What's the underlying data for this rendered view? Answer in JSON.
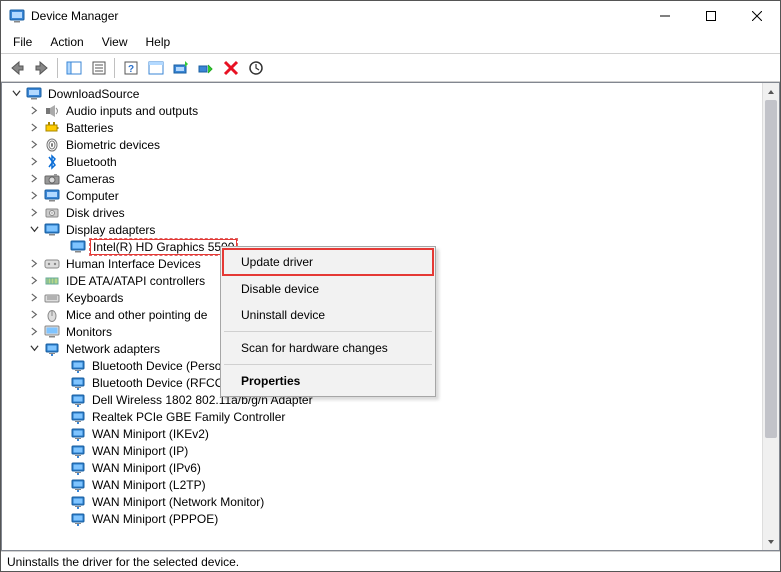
{
  "window": {
    "title": "Device Manager"
  },
  "menus": {
    "file": "File",
    "action": "Action",
    "view": "View",
    "help": "Help"
  },
  "status": "Uninstalls the driver for the selected device.",
  "root": "DownloadSource",
  "categories": [
    {
      "label": "Audio inputs and outputs",
      "icon": "audio",
      "collapsed": true
    },
    {
      "label": "Batteries",
      "icon": "battery",
      "collapsed": true
    },
    {
      "label": "Biometric devices",
      "icon": "biometric",
      "collapsed": true
    },
    {
      "label": "Bluetooth",
      "icon": "bluetooth",
      "collapsed": true
    },
    {
      "label": "Cameras",
      "icon": "camera",
      "collapsed": true
    },
    {
      "label": "Computer",
      "icon": "computer",
      "collapsed": true
    },
    {
      "label": "Disk drives",
      "icon": "disk",
      "collapsed": true
    },
    {
      "label": "Display adapters",
      "icon": "display",
      "collapsed": false,
      "children": [
        {
          "label": "Intel(R) HD Graphics 5500",
          "icon": "display",
          "selected": true
        }
      ]
    },
    {
      "label": "Human Interface Devices",
      "icon": "hid",
      "collapsed": true
    },
    {
      "label": "IDE ATA/ATAPI controllers",
      "icon": "ide",
      "collapsed": true
    },
    {
      "label": "Keyboards",
      "icon": "keyboard",
      "collapsed": true
    },
    {
      "label": "Mice and other pointing de",
      "icon": "mouse",
      "collapsed": true,
      "truncated": true
    },
    {
      "label": "Monitors",
      "icon": "monitor",
      "collapsed": true
    },
    {
      "label": "Network adapters",
      "icon": "network",
      "collapsed": false,
      "children": [
        {
          "label": "Bluetooth Device (Perso",
          "icon": "network",
          "truncated": true
        },
        {
          "label": "Bluetooth Device (RFCOMM Protocol TDI)",
          "icon": "network"
        },
        {
          "label": "Dell Wireless 1802 802.11a/b/g/n Adapter",
          "icon": "network"
        },
        {
          "label": "Realtek PCIe GBE Family Controller",
          "icon": "network"
        },
        {
          "label": "WAN Miniport (IKEv2)",
          "icon": "network"
        },
        {
          "label": "WAN Miniport (IP)",
          "icon": "network"
        },
        {
          "label": "WAN Miniport (IPv6)",
          "icon": "network"
        },
        {
          "label": "WAN Miniport (L2TP)",
          "icon": "network"
        },
        {
          "label": "WAN Miniport (Network Monitor)",
          "icon": "network"
        },
        {
          "label": "WAN Miniport (PPPOE)",
          "icon": "network",
          "cutoff": true
        }
      ]
    }
  ],
  "context_menu": {
    "items": [
      {
        "label": "Update driver",
        "highlighted": true
      },
      {
        "label": "Disable device"
      },
      {
        "label": "Uninstall device"
      },
      {
        "sep": true
      },
      {
        "label": "Scan for hardware changes"
      },
      {
        "sep": true
      },
      {
        "label": "Properties",
        "bold": true
      }
    ]
  }
}
